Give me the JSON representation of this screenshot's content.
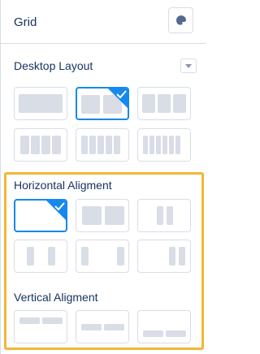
{
  "header": {
    "title": "Grid",
    "settings_icon": "paint-drop-icon"
  },
  "desktop_layout": {
    "label": "Desktop Layout",
    "collapse_icon": "chevron-down-icon",
    "options": [
      {
        "name": "one-column",
        "selected": false
      },
      {
        "name": "two-columns",
        "selected": true
      },
      {
        "name": "three-columns",
        "selected": false
      },
      {
        "name": "four-columns",
        "selected": false
      },
      {
        "name": "five-columns",
        "selected": false
      },
      {
        "name": "six-columns",
        "selected": false
      }
    ]
  },
  "horizontal_alignment": {
    "label": "Horizontal Aligment",
    "options": [
      {
        "name": "none",
        "selected": true
      },
      {
        "name": "stretch",
        "selected": false
      },
      {
        "name": "center",
        "selected": false
      },
      {
        "name": "space-around",
        "selected": false
      },
      {
        "name": "space-between",
        "selected": false
      },
      {
        "name": "end",
        "selected": false
      }
    ]
  },
  "vertical_alignment": {
    "label": "Vertical Aligment",
    "options": [
      {
        "name": "top",
        "selected": false
      },
      {
        "name": "middle",
        "selected": false
      },
      {
        "name": "bottom",
        "selected": false
      }
    ]
  },
  "colors": {
    "accent": "#1589ee",
    "highlight": "#f2b636",
    "text": "#16325c",
    "border": "#d8dde6"
  }
}
